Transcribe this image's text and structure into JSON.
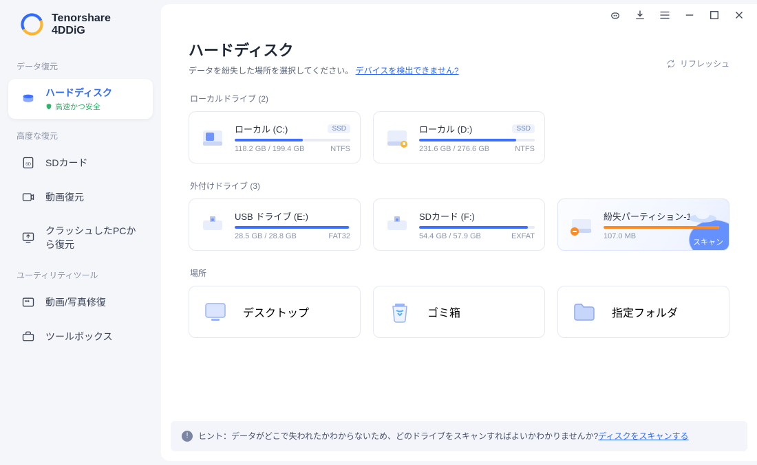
{
  "app": {
    "name": "Tenorshare 4DDiG"
  },
  "sidebar": {
    "sections": {
      "data_recovery": "データ復元",
      "advanced": "高度な復元",
      "utility": "ユーティリティツール"
    },
    "items": {
      "hard_disk": {
        "label": "ハードディスク",
        "sub": "高速かつ安全"
      },
      "sd_card": {
        "label": "SDカード"
      },
      "video": {
        "label": "動画復元"
      },
      "crash_pc": {
        "label": "クラッシュしたPCから復元"
      },
      "repair": {
        "label": "動画/写真修復"
      },
      "toolbox": {
        "label": "ツールボックス"
      }
    }
  },
  "header": {
    "title": "ハードディスク",
    "subtitle_pre": "データを紛失した場所を選択してください。",
    "subtitle_link": "デバイスを検出できません?",
    "refresh": "リフレッシュ"
  },
  "sections": {
    "local_label": "ローカルドライブ (2)",
    "external_label": "外付けドライブ (3)",
    "locations_label": "場所"
  },
  "drives": {
    "local": [
      {
        "name": "ローカル (C:)",
        "size": "118.2 GB / 199.4 GB",
        "fs": "NTFS",
        "ssd": "SSD",
        "fill": 59
      },
      {
        "name": "ローカル (D:)",
        "size": "231.6 GB / 276.6 GB",
        "fs": "NTFS",
        "ssd": "SSD",
        "fill": 84
      }
    ],
    "external": [
      {
        "name": "USB ドライブ (E:)",
        "size": "28.5 GB / 28.8 GB",
        "fs": "FAT32",
        "fill": 99
      },
      {
        "name": "SDカード (F:)",
        "size": "54.4 GB / 57.9 GB",
        "fs": "EXFAT",
        "fill": 94
      },
      {
        "name": "紛失パーティション-1",
        "size": "107.0 MB",
        "fs": "",
        "fill": 100,
        "scan": "スキャン"
      }
    ]
  },
  "locations": {
    "desktop": "デスクトップ",
    "trash": "ゴミ箱",
    "folder": "指定フォルダ"
  },
  "hint": {
    "text": "ヒント：データがどこで失われたかわからないため、どのドライブをスキャンすればよいかわかりませんか?",
    "link": "ディスクをスキャンする"
  }
}
